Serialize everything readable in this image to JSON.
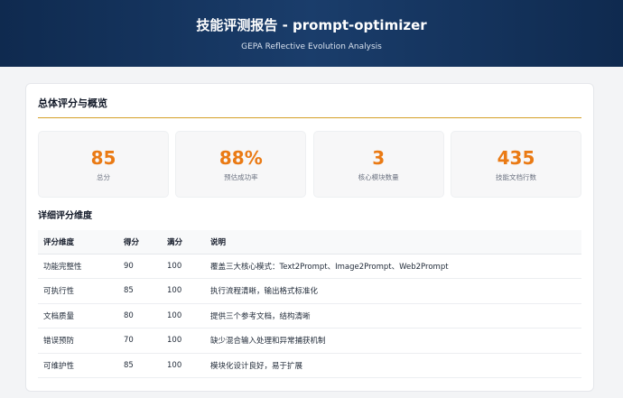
{
  "header": {
    "title": "技能评测报告 - prompt-optimizer",
    "subtitle": "GEPA Reflective Evolution Analysis"
  },
  "overview": {
    "title": "总体评分与概览",
    "stats": [
      {
        "value": "85",
        "label": "总分"
      },
      {
        "value": "88%",
        "label": "预估成功率"
      },
      {
        "value": "3",
        "label": "核心模块数量"
      },
      {
        "value": "435",
        "label": "技能文档行数"
      }
    ]
  },
  "details": {
    "title": "详细评分维度",
    "columns": [
      "评分维度",
      "得分",
      "满分",
      "说明"
    ],
    "rows": [
      [
        "功能完整性",
        "90",
        "100",
        "覆盖三大核心模式：Text2Prompt、Image2Prompt、Web2Prompt"
      ],
      [
        "可执行性",
        "85",
        "100",
        "执行流程清晰，输出格式标准化"
      ],
      [
        "文档质量",
        "80",
        "100",
        "提供三个参考文档，结构清晰"
      ],
      [
        "错误预防",
        "70",
        "100",
        "缺少混合输入处理和异常捕获机制"
      ],
      [
        "可维护性",
        "85",
        "100",
        "模块化设计良好，易于扩展"
      ]
    ]
  },
  "colors": {
    "header_bg": "#0f2a4f",
    "accent": "#ea7a14",
    "divider": "#d4a026"
  }
}
